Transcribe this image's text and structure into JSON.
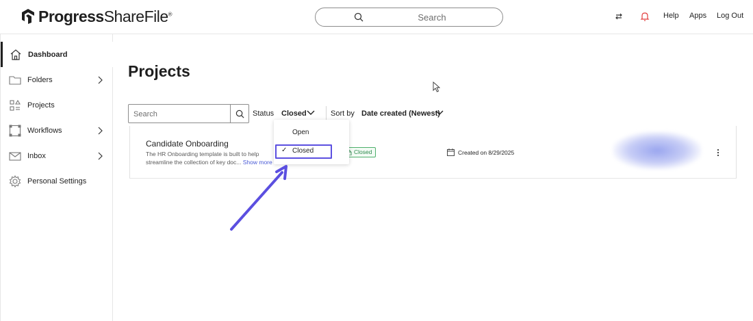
{
  "header": {
    "brand_bold": "Progress",
    "brand_light": "ShareFile",
    "search_placeholder": "Search",
    "links": {
      "help": "Help",
      "apps": "Apps",
      "logout": "Log Out"
    },
    "icons": [
      "transfer-arrows-icon",
      "bell-icon"
    ]
  },
  "sidebar": {
    "items": [
      {
        "label": "Dashboard",
        "icon": "home-icon",
        "active": true,
        "has_chevron": false
      },
      {
        "label": "Folders",
        "icon": "folder-icon",
        "has_chevron": true
      },
      {
        "label": "Projects",
        "icon": "projects-icon",
        "has_chevron": false
      },
      {
        "label": "Workflows",
        "icon": "workflows-icon",
        "has_chevron": true
      },
      {
        "label": "Inbox",
        "icon": "envelope-icon",
        "has_chevron": true
      },
      {
        "label": "Personal Settings",
        "icon": "gear-icon",
        "has_chevron": false
      }
    ]
  },
  "main": {
    "title": "Projects",
    "search_placeholder": "Search",
    "status_label": "Status",
    "status_value": "Closed",
    "sort_label": "Sort by",
    "sort_value": "Date created (Newest)"
  },
  "dropdown": {
    "options": [
      {
        "label": "Open",
        "selected": false
      },
      {
        "label": "Closed",
        "selected": true,
        "check": "✓"
      }
    ]
  },
  "project": {
    "title": "Candidate Onboarding",
    "description": "The HR Onboarding template is built to help streamline the collection of key doc...",
    "show_more": "Show more",
    "status_badge": "Closed",
    "created": "Created on 8/29/2025"
  },
  "colors": {
    "accent": "#5b4fe0",
    "badge_green": "#2e8b4e",
    "link_blue": "#4a5bd6"
  }
}
